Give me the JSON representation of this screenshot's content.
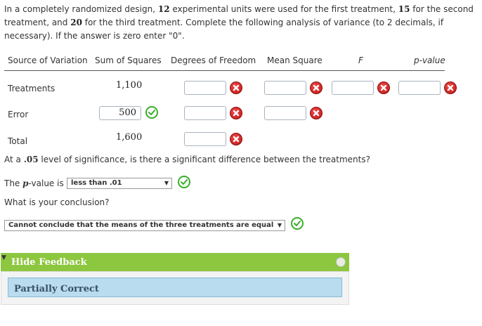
{
  "intro": {
    "t1": "In a completely randomized design, ",
    "n1": "12",
    "t2": " experimental units were used for the first treatment, ",
    "n2": "15",
    "t3": " for the second treatment, and ",
    "n3": "20",
    "t4": " for the third treatment. Complete the following analysis of variance (to 2 decimals, if necessary). If the answer is zero enter \"0\"."
  },
  "table": {
    "headers": [
      "Source of Variation",
      "Sum of Squares",
      "Degrees of Freedom",
      "Mean Square",
      "F",
      "p-value"
    ],
    "rows": [
      {
        "label": "Treatments",
        "ss": "1,100"
      },
      {
        "label": "Error",
        "ss": "500"
      },
      {
        "label": "Total",
        "ss": "1,600"
      }
    ],
    "inputs": {
      "df_treat": "",
      "ms_treat": "",
      "f": "",
      "p": "",
      "df_error": "",
      "ms_error": "",
      "df_total": ""
    }
  },
  "question1": {
    "prefix": "At a ",
    "alpha": ".05",
    "suffix": " level of significance, is there a significant difference between the treatments?"
  },
  "pvalue_line": {
    "prefix": "The ",
    "p": "p",
    "suffix": "-value is",
    "selected": "less than .01"
  },
  "question2": "What is your conclusion?",
  "conclusion": {
    "selected": "Cannot conclude that the means of the three treatments are equal"
  },
  "feedback": {
    "toggle_label": "Hide Feedback",
    "status": "Partially Correct"
  },
  "colors": {
    "correct": "#3aae2a",
    "incorrect": "#d11b1b",
    "feedback_bar": "#8dc63f",
    "feedback_inner": "#b9dcef"
  }
}
